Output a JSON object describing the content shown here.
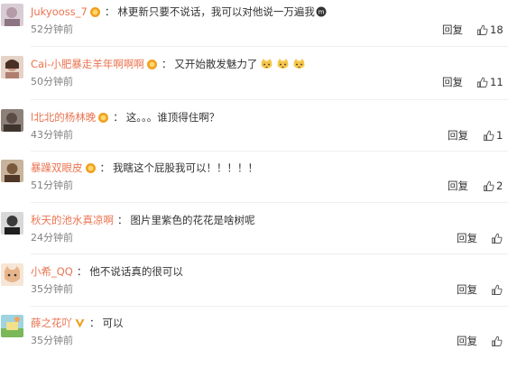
{
  "comments": [
    {
      "user": "Jukyooss_7",
      "sep": "：",
      "text": "林更新只要不说话，我可以对他说一万遍我",
      "time": "52分钟前",
      "reply": "回复",
      "likes": "18",
      "emojis": [],
      "inline_icon": "fan-icon",
      "avatar_color": "#c8b9c3"
    },
    {
      "user": "Cai-小肥暴走羊年啊啊啊",
      "sep": "：",
      "text": "又开始散发魅力了",
      "time": "50分钟前",
      "reply": "回复",
      "likes": "11",
      "emojis": [
        "cat-face-emoji",
        "cat-face-emoji",
        "cat-face-emoji"
      ],
      "avatar_color": "#c9a08c"
    },
    {
      "user": "l北北的杨林晚",
      "sep": "：",
      "text": "这。。。谁顶得住啊？",
      "time": "43分钟前",
      "reply": "回复",
      "likes": "1",
      "emojis": [],
      "avatar_color": "#5b4d45"
    },
    {
      "user": "暴躁双眼皮",
      "sep": "：",
      "text": "我瞎这个屁股我可以！！！！！",
      "time": "51分钟前",
      "reply": "回复",
      "likes": "2",
      "emojis": [],
      "avatar_color": "#7a5a3c"
    },
    {
      "user": "秋天的池水真凉啊",
      "sep": "：",
      "text": "图片里紫色的花花是啥树呢",
      "time": "24分钟前",
      "reply": "回复",
      "likes": "",
      "emojis": [],
      "avatar_color": "#3a3a3a"
    },
    {
      "user": "小希_QQ",
      "sep": "：",
      "text": "他不说话真的很可以",
      "time": "35分钟前",
      "reply": "回复",
      "likes": "",
      "emojis": [],
      "avatar_color": "#e8b48a"
    },
    {
      "user": "薛之花吖",
      "sep": "：",
      "text": "可以",
      "time": "35分钟前",
      "reply": "回复",
      "likes": "",
      "emojis": [],
      "avatar_color": "#6fb3c9",
      "verified": true
    }
  ],
  "colors": {
    "username": "#eb7350",
    "text": "#333333",
    "time": "#808080",
    "medal": "#f0a020"
  }
}
